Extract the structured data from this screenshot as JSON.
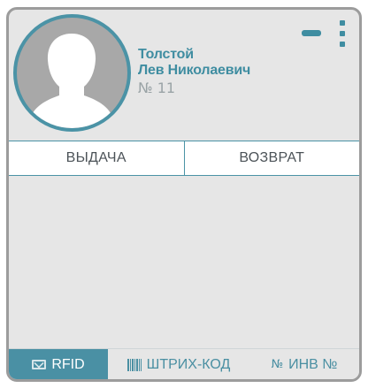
{
  "reader": {
    "surname": "Толстой",
    "given_names": "Лев Николаевич",
    "number_label": "№ 11"
  },
  "avatar": {
    "icon": "user-silhouette-icon"
  },
  "header_controls": {
    "minimize_icon": "minus-icon",
    "menu_icon": "vertical-dots-icon"
  },
  "tabs": [
    {
      "label": "ВЫДАЧА"
    },
    {
      "label": "ВОЗВРАТ"
    }
  ],
  "identification_modes": [
    {
      "label": "RFID",
      "icon": "rfid-card-icon",
      "active": true
    },
    {
      "label": "ШТРИХ-КОД",
      "icon": "barcode-icon",
      "active": false
    },
    {
      "label": "ИНВ №",
      "icon": "number-sign-icon",
      "icon_text": "№",
      "active": false
    }
  ],
  "colors": {
    "accent": "#4a90a4",
    "panel_bg": "#e6e6e6",
    "border": "#9c9c9c",
    "text": "#4c5358"
  }
}
